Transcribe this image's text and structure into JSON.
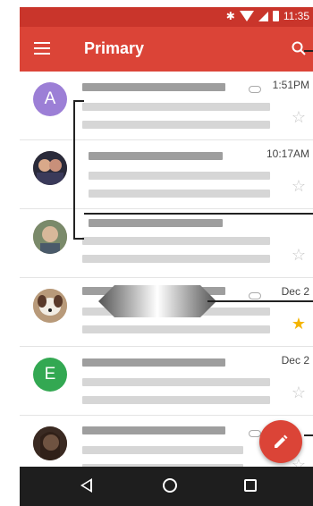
{
  "status_bar": {
    "time": "11:35",
    "bluetooth": "✱"
  },
  "app_bar": {
    "title": "Primary"
  },
  "emails": [
    {
      "avatar_letter": "A",
      "avatar_color": "#9c7fd6",
      "time": "1:51PM",
      "has_attachment": true,
      "starred": false
    },
    {
      "avatar_letter": "",
      "avatar_color": "#6b4a3a",
      "time": "10:17AM",
      "has_attachment": false,
      "starred": false
    },
    {
      "avatar_letter": "",
      "avatar_color": "#8a7a5a",
      "time": "",
      "has_attachment": false,
      "starred": false
    },
    {
      "avatar_letter": "",
      "avatar_color": "#c4a27a",
      "time": "Dec 2",
      "has_attachment": true,
      "starred": true
    },
    {
      "avatar_letter": "E",
      "avatar_color": "#33a852",
      "time": "Dec 2",
      "has_attachment": false,
      "starred": false
    },
    {
      "avatar_letter": "",
      "avatar_color": "#5a3a2a",
      "time": "",
      "has_attachment": true,
      "starred": false
    }
  ],
  "icons": {
    "menu": "menu-icon",
    "search": "search-icon",
    "compose": "pencil-icon",
    "star": "☆",
    "star_filled": "★"
  },
  "colors": {
    "primary": "#db4437",
    "status_bar": "#c9352b",
    "star": "#f4b400"
  }
}
